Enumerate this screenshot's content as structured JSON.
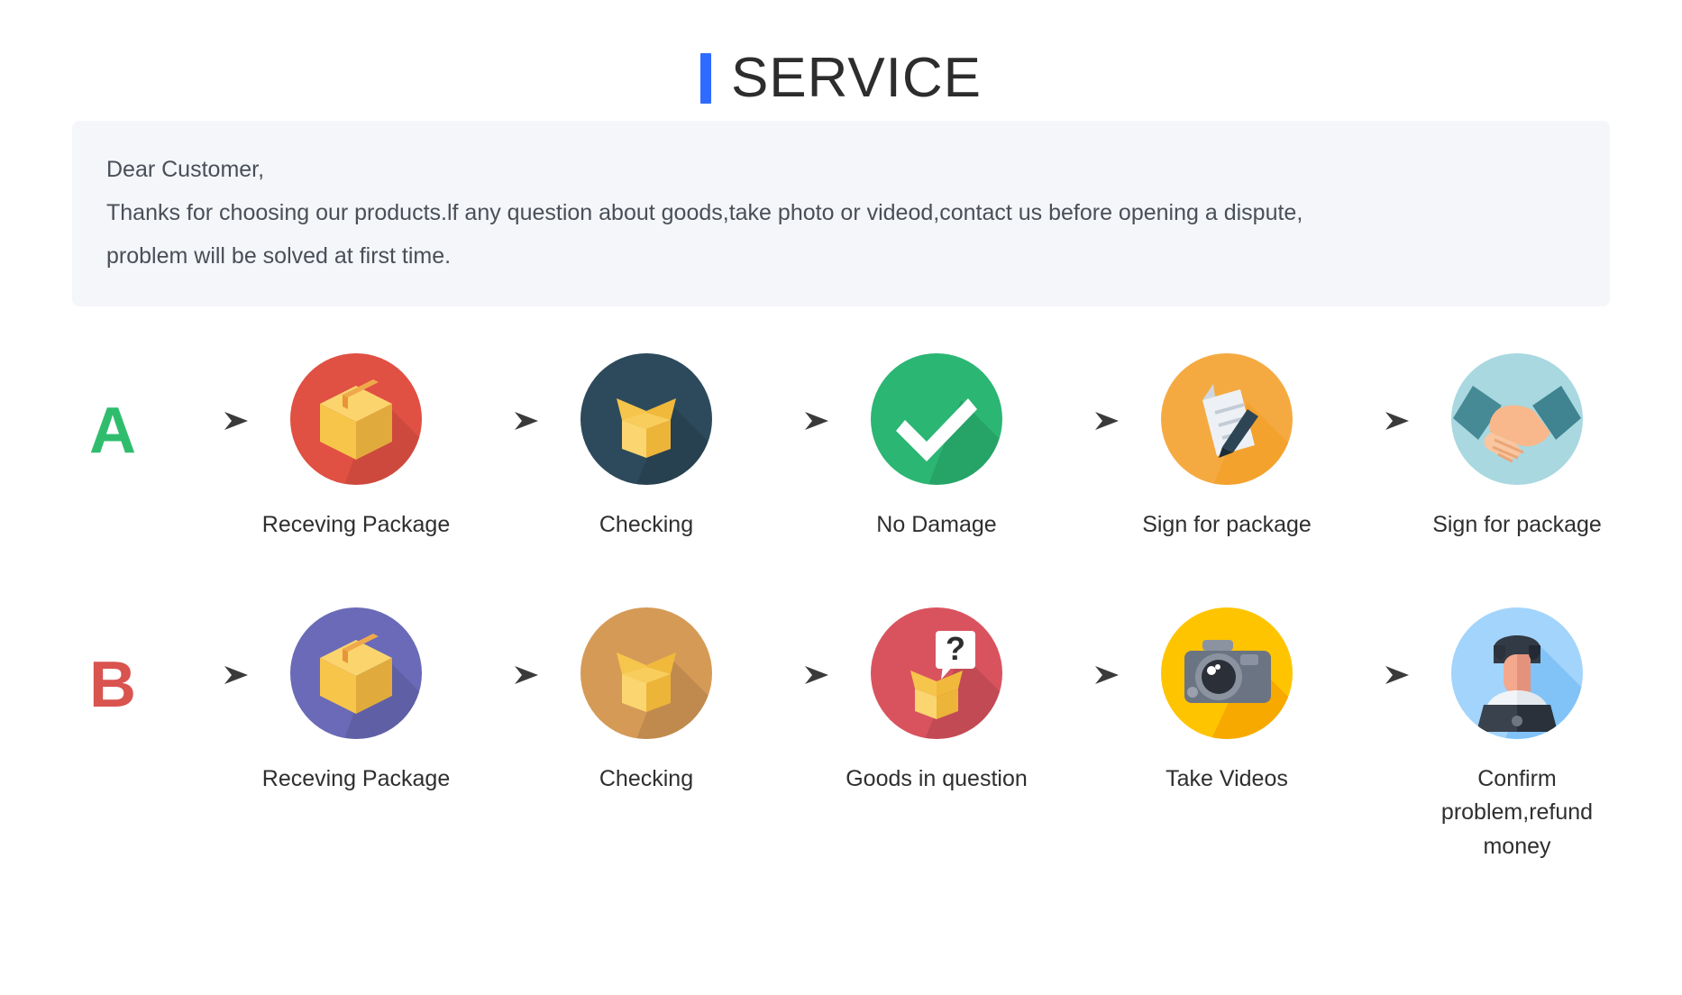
{
  "header": {
    "accent_color": "#2f6bff",
    "title": "SERVICE"
  },
  "notice": {
    "line1": "Dear Customer,",
    "line2": "Thanks for choosing our products.lf any question about goods,take photo or videod,contact us before opening a dispute,",
    "line3": "problem will be solved at first time.",
    "background_color": "#f4f6fa"
  },
  "flows": [
    {
      "badge": "A",
      "badge_color": "#2fbd6d",
      "steps": [
        {
          "label": "Receving Package",
          "icon": "package-box-icon",
          "circle_color": "#e05043"
        },
        {
          "label": "Checking",
          "icon": "open-box-icon",
          "circle_color": "#2d4a5c"
        },
        {
          "label": "No Damage",
          "icon": "checkmark-icon",
          "circle_color": "#2bb673"
        },
        {
          "label": "Sign for package",
          "icon": "document-pen-icon",
          "circle_color": "#f5aa41"
        },
        {
          "label": "Sign for package",
          "icon": "handshake-icon",
          "circle_color": "#a9d8e0"
        }
      ]
    },
    {
      "badge": "B",
      "badge_color": "#d9534f",
      "steps": [
        {
          "label": "Receving Package",
          "icon": "package-box-icon",
          "circle_color": "#6a6ab8"
        },
        {
          "label": "Checking",
          "icon": "open-box-icon",
          "circle_color": "#d69a57"
        },
        {
          "label": "Goods in question",
          "icon": "question-box-icon",
          "circle_color": "#d9535f"
        },
        {
          "label": "Take Videos",
          "icon": "camera-icon",
          "circle_color": "#ffc400"
        },
        {
          "label": "Confirm problem,refund\nmoney",
          "icon": "support-agent-icon",
          "circle_color": "#a3d4fb"
        }
      ]
    }
  ],
  "arrow": {
    "name": "arrow-right-icon",
    "color": "#3f3f3f"
  }
}
